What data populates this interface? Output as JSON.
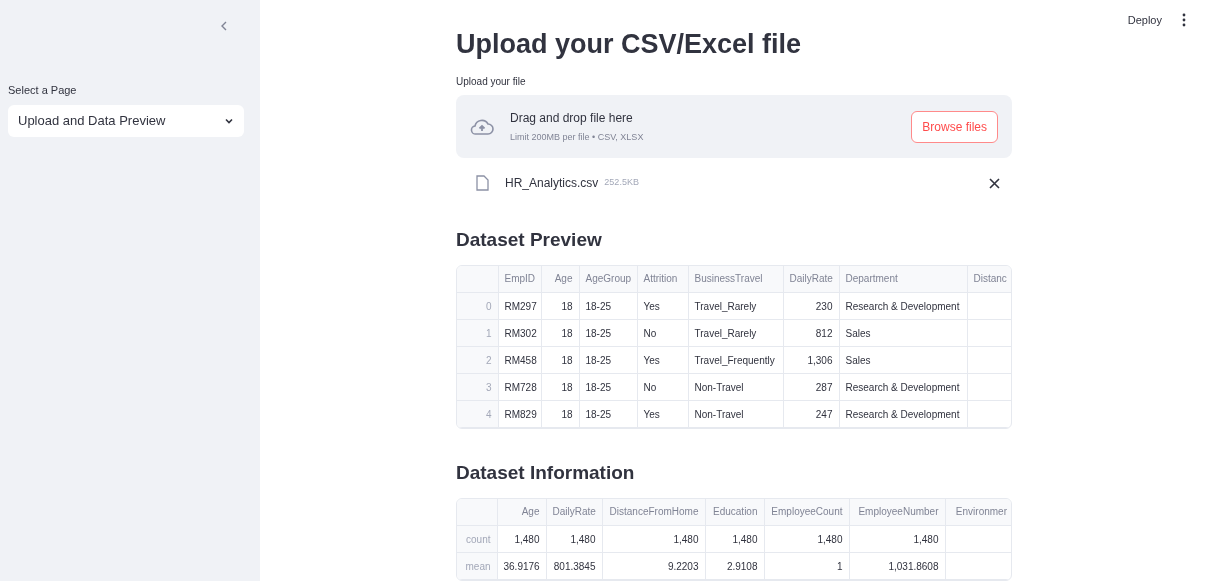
{
  "sidebar": {
    "select_label": "Select a Page",
    "select_value": "Upload and Data Preview"
  },
  "header": {
    "deploy": "Deploy"
  },
  "title": "Upload your CSV/Excel file",
  "uploader": {
    "label": "Upload your file",
    "drop_text": "Drag and drop file here",
    "limit_text": "Limit 200MB per file • CSV, XLSX",
    "button": "Browse files"
  },
  "file": {
    "name": "HR_Analytics.csv",
    "size": "252.5KB"
  },
  "preview": {
    "heading": "Dataset Preview",
    "table": {
      "columns": [
        "EmpID",
        "Age",
        "AgeGroup",
        "Attrition",
        "BusinessTravel",
        "DailyRate",
        "Department",
        "Distanc"
      ],
      "rows": [
        {
          "index": "0",
          "cells": [
            "RM297",
            "18",
            "18-25",
            "Yes",
            "Travel_Rarely",
            "230",
            "Research & Development"
          ]
        },
        {
          "index": "1",
          "cells": [
            "RM302",
            "18",
            "18-25",
            "No",
            "Travel_Rarely",
            "812",
            "Sales"
          ]
        },
        {
          "index": "2",
          "cells": [
            "RM458",
            "18",
            "18-25",
            "Yes",
            "Travel_Frequently",
            "1,306",
            "Sales"
          ]
        },
        {
          "index": "3",
          "cells": [
            "RM728",
            "18",
            "18-25",
            "No",
            "Non-Travel",
            "287",
            "Research & Development"
          ]
        },
        {
          "index": "4",
          "cells": [
            "RM829",
            "18",
            "18-25",
            "Yes",
            "Non-Travel",
            "247",
            "Research & Development"
          ]
        }
      ]
    }
  },
  "info": {
    "heading": "Dataset Information",
    "table": {
      "columns": [
        "Age",
        "DailyRate",
        "DistanceFromHome",
        "Education",
        "EmployeeCount",
        "EmployeeNumber",
        "Environmer"
      ],
      "rows": [
        {
          "index": "count",
          "cells": [
            "1,480",
            "1,480",
            "1,480",
            "1,480",
            "1,480",
            "1,480"
          ]
        },
        {
          "index": "mean",
          "cells": [
            "36.9176",
            "801.3845",
            "9.2203",
            "2.9108",
            "1",
            "1,031.8608"
          ]
        }
      ]
    }
  }
}
